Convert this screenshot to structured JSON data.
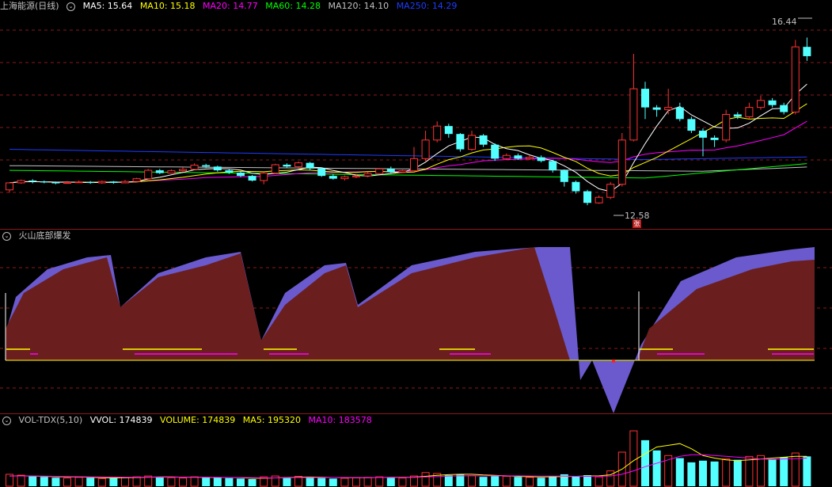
{
  "main": {
    "stock_title": "上海能源(日线)",
    "ma": [
      {
        "label": "MA5: 15.64",
        "color": "#ffffff"
      },
      {
        "label": "MA10: 15.18",
        "color": "#ffff00"
      },
      {
        "label": "MA20: 14.77",
        "color": "#ff00ff"
      },
      {
        "label": "MA60: 14.28",
        "color": "#00ff00"
      },
      {
        "label": "MA120: 14.10",
        "color": "#c0c0c0"
      },
      {
        "label": "MA250: 14.29",
        "color": "#1e3cff"
      }
    ],
    "high_label": "16.44",
    "low_label": "12.58",
    "marker": "张"
  },
  "indicator": {
    "title": "火山底部爆发"
  },
  "volume": {
    "title": "VOL-TDX(5,10)",
    "items": [
      {
        "label": "VVOL: 174839",
        "color": "#ffffff"
      },
      {
        "label": "VOLUME: 174839",
        "color": "#ffff00"
      },
      {
        "label": "MA5: 195320",
        "color": "#ffff00"
      },
      {
        "label": "MA10: 183578",
        "color": "#ff00ff"
      }
    ]
  },
  "colors": {
    "up": "#ff3232",
    "down": "#54ffff",
    "grid": "#8b1a1a",
    "area_blue": "#6a5acd",
    "area_red": "#6b1e1e"
  },
  "chart_data": {
    "type": "candlestick",
    "candles": [
      [
        12.88,
        13.03,
        13.04,
        12.82
      ],
      [
        13.03,
        13.08,
        13.1,
        13.01
      ],
      [
        13.08,
        13.06,
        13.11,
        13.02
      ],
      [
        13.06,
        13.04,
        13.08,
        13.02
      ],
      [
        13.04,
        13.02,
        13.06,
        13.0
      ],
      [
        13.02,
        13.04,
        13.07,
        13.01
      ],
      [
        13.04,
        13.05,
        13.08,
        13.03
      ],
      [
        13.05,
        13.03,
        13.07,
        13.01
      ],
      [
        13.03,
        13.06,
        13.08,
        13.01
      ],
      [
        13.06,
        13.03,
        13.07,
        13.01
      ],
      [
        13.03,
        13.06,
        13.09,
        13.02
      ],
      [
        13.06,
        13.12,
        13.14,
        13.05
      ],
      [
        13.12,
        13.3,
        13.33,
        13.11
      ],
      [
        13.3,
        13.24,
        13.33,
        13.22
      ],
      [
        13.24,
        13.29,
        13.32,
        13.23
      ],
      [
        13.29,
        13.32,
        13.36,
        13.27
      ],
      [
        13.32,
        13.41,
        13.45,
        13.31
      ],
      [
        13.41,
        13.38,
        13.44,
        13.35
      ],
      [
        13.38,
        13.3,
        13.4,
        13.27
      ],
      [
        13.3,
        13.25,
        13.32,
        13.22
      ],
      [
        13.25,
        13.18,
        13.27,
        13.15
      ],
      [
        13.18,
        13.08,
        13.2,
        13.06
      ],
      [
        13.08,
        13.24,
        13.26,
        13.0
      ],
      [
        13.24,
        13.42,
        13.44,
        13.22
      ],
      [
        13.42,
        13.38,
        13.45,
        13.36
      ],
      [
        13.38,
        13.46,
        13.49,
        13.35
      ],
      [
        13.46,
        13.34,
        13.48,
        13.3
      ],
      [
        13.34,
        13.18,
        13.36,
        13.16
      ],
      [
        13.18,
        13.12,
        13.22,
        13.1
      ],
      [
        13.12,
        13.16,
        13.19,
        13.08
      ],
      [
        13.16,
        13.18,
        13.22,
        13.13
      ],
      [
        13.18,
        13.23,
        13.26,
        13.15
      ],
      [
        13.23,
        13.33,
        13.35,
        13.22
      ],
      [
        13.33,
        13.26,
        13.38,
        13.24
      ],
      [
        13.26,
        13.29,
        13.31,
        13.25
      ],
      [
        13.29,
        13.55,
        13.8,
        13.28
      ],
      [
        13.55,
        13.95,
        14.15,
        13.5
      ],
      [
        13.95,
        14.25,
        14.35,
        13.9
      ],
      [
        14.25,
        14.08,
        14.3,
        14.0
      ],
      [
        14.08,
        13.75,
        14.1,
        13.7
      ],
      [
        13.75,
        14.05,
        14.15,
        13.72
      ],
      [
        14.05,
        13.85,
        14.08,
        13.8
      ],
      [
        13.85,
        13.55,
        13.88,
        13.5
      ],
      [
        13.55,
        13.62,
        13.66,
        13.52
      ],
      [
        13.62,
        13.55,
        13.66,
        13.52
      ],
      [
        13.55,
        13.58,
        13.62,
        13.52
      ],
      [
        13.58,
        13.5,
        13.62,
        13.47
      ],
      [
        13.5,
        13.3,
        13.52,
        13.25
      ],
      [
        13.3,
        13.05,
        13.32,
        12.95
      ],
      [
        13.05,
        12.85,
        13.08,
        12.8
      ],
      [
        12.85,
        12.6,
        12.88,
        12.55
      ],
      [
        12.6,
        12.72,
        12.76,
        12.58
      ],
      [
        12.72,
        13.0,
        13.05,
        12.68
      ],
      [
        13.0,
        13.95,
        14.1,
        12.95
      ],
      [
        13.95,
        15.05,
        15.8,
        13.92
      ],
      [
        15.05,
        14.65,
        15.2,
        14.4
      ],
      [
        14.65,
        14.6,
        14.7,
        14.45
      ],
      [
        14.6,
        14.65,
        15.05,
        14.5
      ],
      [
        14.65,
        14.4,
        14.75,
        14.35
      ],
      [
        14.4,
        14.15,
        14.45,
        14.1
      ],
      [
        14.15,
        14.0,
        14.2,
        13.6
      ],
      [
        14.0,
        13.95,
        14.05,
        13.8
      ],
      [
        13.95,
        14.5,
        14.6,
        13.9
      ],
      [
        14.5,
        14.45,
        14.55,
        14.4
      ],
      [
        14.45,
        14.65,
        14.75,
        14.4
      ],
      [
        14.65,
        14.8,
        14.9,
        14.6
      ],
      [
        14.8,
        14.7,
        14.85,
        14.65
      ],
      [
        14.7,
        14.55,
        14.75,
        14.5
      ],
      [
        14.55,
        15.95,
        16.1,
        14.5
      ],
      [
        15.95,
        15.75,
        16.15,
        15.65
      ]
    ],
    "volumes": [
      70,
      65,
      60,
      55,
      50,
      48,
      52,
      50,
      45,
      48,
      50,
      55,
      60,
      52,
      50,
      48,
      55,
      52,
      50,
      48,
      45,
      42,
      55,
      60,
      52,
      58,
      55,
      48,
      45,
      47,
      50,
      52,
      55,
      50,
      48,
      60,
      80,
      75,
      65,
      70,
      62,
      55,
      60,
      58,
      55,
      52,
      50,
      58,
      70,
      60,
      65,
      55,
      90,
      200,
      325,
      270,
      210,
      180,
      165,
      140,
      150,
      145,
      160,
      155,
      175,
      180,
      160,
      170,
      195,
      175
    ],
    "volume_ma5": [
      60,
      61,
      59,
      58,
      56,
      55,
      55,
      52,
      50,
      49,
      50,
      51,
      53,
      55,
      55,
      53,
      53,
      52,
      51,
      51,
      50,
      47,
      47,
      49,
      51,
      53,
      54,
      53,
      51,
      50,
      50,
      50,
      51,
      52,
      52,
      53,
      58,
      64,
      68,
      70,
      70,
      66,
      64,
      61,
      58,
      56,
      55,
      56,
      57,
      58,
      60,
      61,
      67,
      100,
      150,
      190,
      230,
      240,
      250,
      220,
      180,
      165,
      155,
      150,
      155,
      160,
      165,
      170,
      175,
      175
    ],
    "volume_ma10": [
      60,
      60,
      60,
      59,
      58,
      57,
      56,
      55,
      54,
      54,
      53,
      53,
      53,
      53,
      53,
      53,
      52,
      52,
      52,
      51,
      51,
      50,
      49,
      49,
      50,
      51,
      51,
      51,
      51,
      51,
      51,
      51,
      51,
      51,
      51,
      52,
      54,
      57,
      60,
      61,
      62,
      61,
      61,
      61,
      61,
      60,
      59,
      59,
      59,
      58,
      58,
      58,
      60,
      70,
      90,
      115,
      135,
      155,
      175,
      185,
      185,
      180,
      175,
      170,
      165,
      160,
      158,
      160,
      162,
      165
    ]
  }
}
